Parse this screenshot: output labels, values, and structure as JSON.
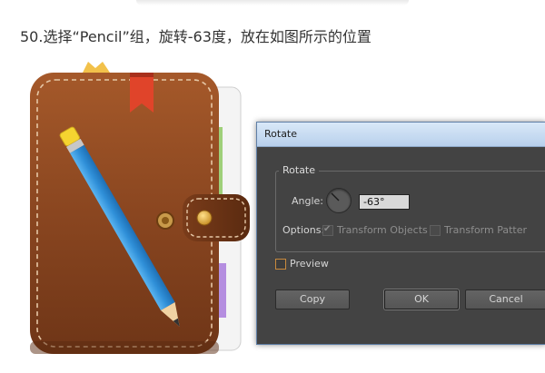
{
  "tutorial": {
    "step_title": "50.选择“Pencil”组，旋转-63度，放在如图所示的位置"
  },
  "dialog": {
    "title": "Rotate",
    "group_label": "Rotate",
    "angle_label": "Angle:",
    "angle_value": "-63°",
    "options_label": "Options:",
    "transform_objects_label": "Transform Objects",
    "transform_objects_checked": true,
    "transform_patterns_label": "Transform Patter",
    "transform_patterns_checked": false,
    "preview_label": "Preview",
    "preview_checked": false,
    "copy_label": "Copy",
    "ok_label": "OK",
    "cancel_label": "Cancel"
  },
  "colors": {
    "leather": "#8a4a22",
    "bookmark_red": "#e0442a",
    "pencil_blue": "#2f8fd8",
    "dialog_bg": "#434343",
    "titlebar": "#c9dcf2"
  }
}
